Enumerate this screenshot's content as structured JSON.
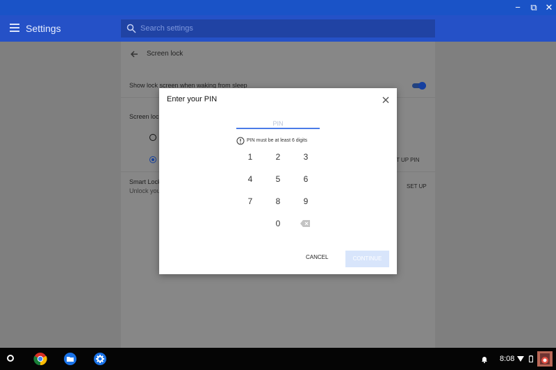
{
  "window": {
    "controls": [
      "−",
      "⧉",
      "✕"
    ]
  },
  "header": {
    "title": "Settings",
    "search_placeholder": "Search settings"
  },
  "screen_lock": {
    "title": "Screen lock",
    "show_lock_screen_label": "Show lock screen when waking from sleep",
    "show_lock_screen_enabled": true,
    "screen_lock_label_partial": "Screen lock",
    "pin_option_button": "T UP PIN",
    "smart_lock_title": "Smart Lock",
    "smart_lock_desc_partial": "Unlock you",
    "smart_lock_button": "SET UP"
  },
  "dialog": {
    "title": "Enter your PIN",
    "pin_placeholder": "PIN",
    "hint": "PIN must be at least 6 digits",
    "keys": [
      "1",
      "2",
      "3",
      "4",
      "5",
      "6",
      "7",
      "8",
      "9",
      "0"
    ],
    "cancel_label": "CANCEL",
    "continue_label": "CONTINUE"
  },
  "shelf": {
    "time": "8:08"
  },
  "colors": {
    "accent": "#2551c7",
    "toggle": "#153f9f",
    "continue_disabled": "#d8e5fb"
  },
  "icons": [
    "menu-icon",
    "search-icon",
    "back-arrow-icon",
    "close-icon",
    "error-icon",
    "backspace-icon",
    "chrome-icon",
    "files-icon",
    "settings-icon",
    "notification-icon",
    "wifi-icon",
    "battery-icon",
    "avatar-icon"
  ]
}
